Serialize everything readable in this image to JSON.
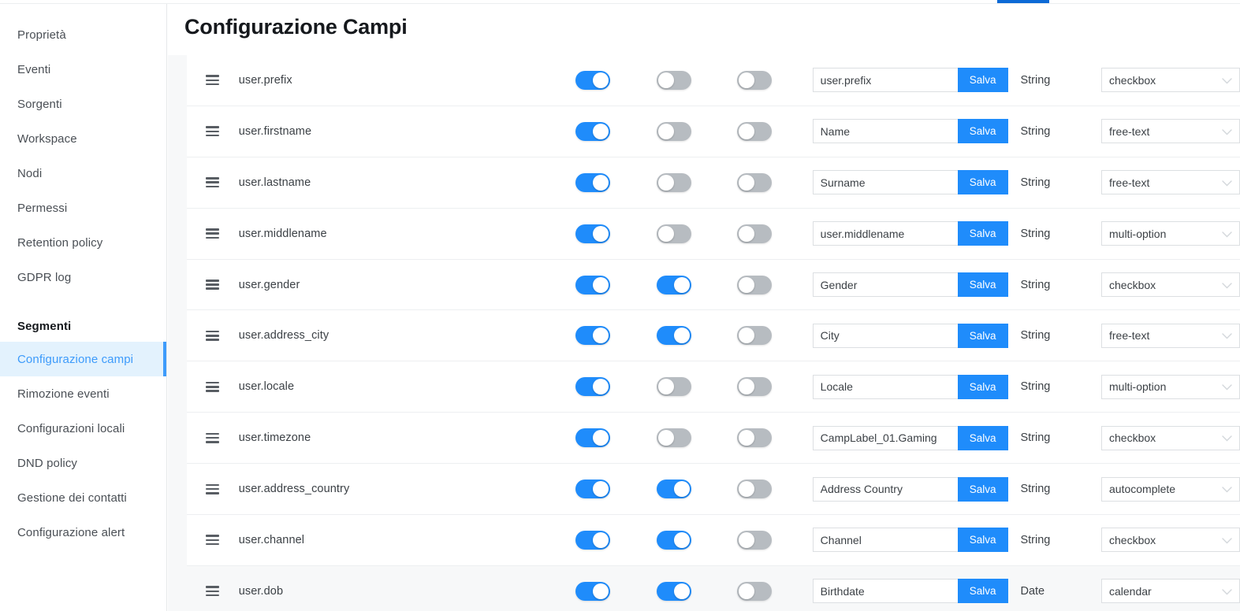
{
  "colors": {
    "accent_blue": "#1f8cfb",
    "tab_indicator": "#0d6ad6",
    "active_nav_bg": "#e3f2fd",
    "active_nav_text": "#3d9bfb",
    "toggle_off": "#b7bcc1",
    "row_shaded": "#f7f8f9"
  },
  "sidebar": {
    "items": [
      {
        "label": "Proprietà",
        "active": false,
        "section": false
      },
      {
        "label": "Eventi",
        "active": false,
        "section": false
      },
      {
        "label": "Sorgenti",
        "active": false,
        "section": false
      },
      {
        "label": "Workspace",
        "active": false,
        "section": false
      },
      {
        "label": "Nodi",
        "active": false,
        "section": false
      },
      {
        "label": "Permessi",
        "active": false,
        "section": false
      },
      {
        "label": "Retention policy",
        "active": false,
        "section": false
      },
      {
        "label": "GDPR log",
        "active": false,
        "section": false
      },
      {
        "label": "Segmenti",
        "active": false,
        "section": true
      },
      {
        "label": "Configurazione campi",
        "active": true,
        "section": false
      },
      {
        "label": "Rimozione eventi",
        "active": false,
        "section": false
      },
      {
        "label": "Configurazioni locali",
        "active": false,
        "section": false
      },
      {
        "label": "DND policy",
        "active": false,
        "section": false
      },
      {
        "label": "Gestione dei contatti",
        "active": false,
        "section": false
      },
      {
        "label": "Configurazione alert",
        "active": false,
        "section": false
      }
    ]
  },
  "main": {
    "page_title": "Configurazione Campi",
    "save_label": "Salva",
    "handle_icon": "drag-handle-icon",
    "chevron_icon": "chevron-down-icon",
    "widget_options": [
      "checkbox",
      "free-text",
      "multi-option",
      "autocomplete",
      "calendar"
    ],
    "rows": [
      {
        "field": "user.prefix",
        "t1": true,
        "t2": false,
        "t3": false,
        "label": "user.prefix",
        "type": "String",
        "widget": "checkbox",
        "shaded": false
      },
      {
        "field": "user.firstname",
        "t1": true,
        "t2": false,
        "t3": false,
        "label": "Name",
        "type": "String",
        "widget": "free-text",
        "shaded": false
      },
      {
        "field": "user.lastname",
        "t1": true,
        "t2": false,
        "t3": false,
        "label": "Surname",
        "type": "String",
        "widget": "free-text",
        "shaded": false
      },
      {
        "field": "user.middlename",
        "t1": true,
        "t2": false,
        "t3": false,
        "label": "user.middlename",
        "type": "String",
        "widget": "multi-option",
        "shaded": false
      },
      {
        "field": "user.gender",
        "t1": true,
        "t2": true,
        "t3": false,
        "label": "Gender",
        "type": "String",
        "widget": "checkbox",
        "shaded": false
      },
      {
        "field": "user.address_city",
        "t1": true,
        "t2": true,
        "t3": false,
        "label": "City",
        "type": "String",
        "widget": "free-text",
        "shaded": false
      },
      {
        "field": "user.locale",
        "t1": true,
        "t2": false,
        "t3": false,
        "label": "Locale",
        "type": "String",
        "widget": "multi-option",
        "shaded": false
      },
      {
        "field": "user.timezone",
        "t1": true,
        "t2": false,
        "t3": false,
        "label": "CampLabel_01.Gaming",
        "type": "String",
        "widget": "checkbox",
        "shaded": false
      },
      {
        "field": "user.address_country",
        "t1": true,
        "t2": true,
        "t3": false,
        "label": "Address Country",
        "type": "String",
        "widget": "autocomplete",
        "shaded": false
      },
      {
        "field": "user.channel",
        "t1": true,
        "t2": true,
        "t3": false,
        "label": "Channel",
        "type": "String",
        "widget": "checkbox",
        "shaded": false
      },
      {
        "field": "user.dob",
        "t1": true,
        "t2": true,
        "t3": false,
        "label": "Birthdate",
        "type": "Date",
        "widget": "calendar",
        "shaded": true
      }
    ]
  }
}
